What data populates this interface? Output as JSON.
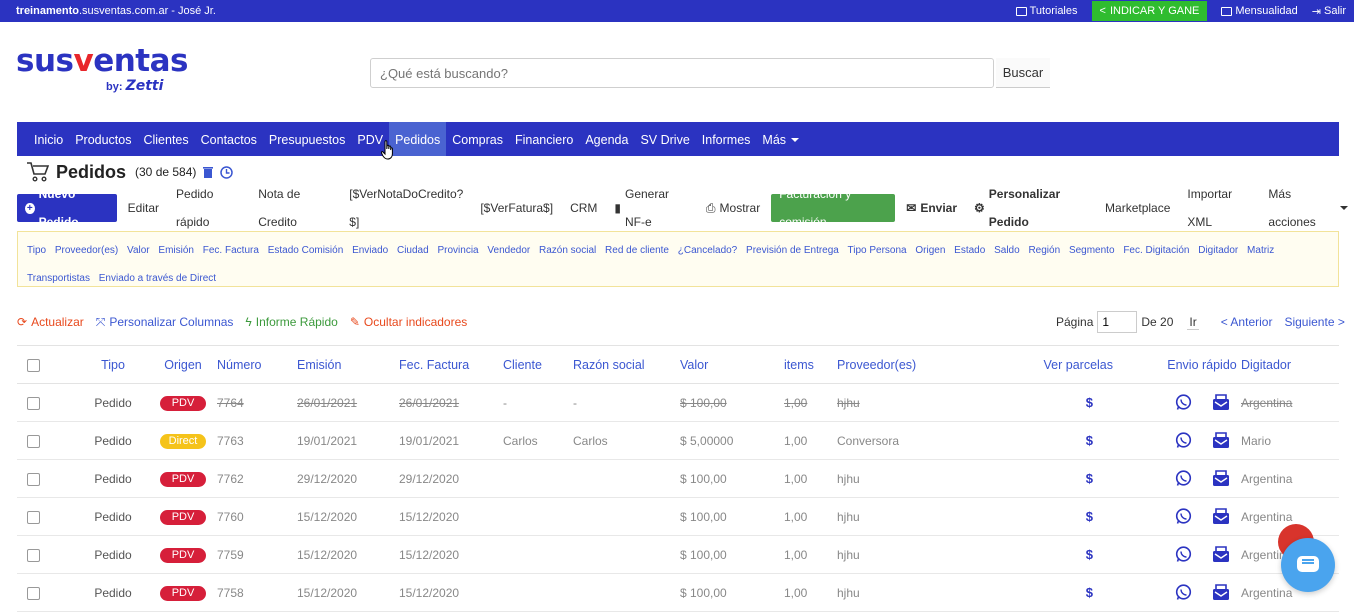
{
  "topbar": {
    "host_bold": "treinamento",
    "host_rest": ".susventas.com.ar - José Jr.",
    "tutoriales": "Tutoriales",
    "indicar": "INDICAR Y GANE",
    "mensualidad": "Mensualidad",
    "salir": "Salir"
  },
  "logo": {
    "brand_a": "sus",
    "brand_v": "v",
    "brand_b": "entas",
    "by": "by:",
    "by_name": "Zetti"
  },
  "search": {
    "placeholder": "¿Qué está buscando?",
    "button": "Buscar"
  },
  "nav": [
    "Inicio",
    "Productos",
    "Clientes",
    "Contactos",
    "Presupuestos",
    "PDV",
    "Pedidos",
    "Compras",
    "Financiero",
    "Agenda",
    "SV Drive",
    "Informes",
    "Más"
  ],
  "nav_active": "Pedidos",
  "page": {
    "title": "Pedidos",
    "count": "(30 de 584)"
  },
  "toolbar": {
    "nuevo": "Nuevo Pedido",
    "editar": "Editar",
    "rapido": "Pedido rápido",
    "nota": "Nota de Credito",
    "vernota": "[$VerNotaDoCredito?$]",
    "verfatura": "[$VerFatura$]",
    "crm": "CRM",
    "nfe": "Generar NF-e",
    "mostrar": "Mostrar",
    "facturacion": "Facturación y comisión",
    "enviar": "Enviar",
    "personalizar": "Personalizar Pedido",
    "marketplace": "Marketplace",
    "importar": "Importar XML",
    "mas": "Más acciones"
  },
  "filters": [
    "Tipo",
    "Proveedor(es)",
    "Valor",
    "Emisión",
    "Fec. Factura",
    "Estado Comisión",
    "Enviado",
    "Ciudad",
    "Provincia",
    "Vendedor",
    "Razón social",
    "Red de cliente",
    "¿Cancelado?",
    "Previsión de Entrega",
    "Tipo Persona",
    "Origen",
    "Estado",
    "Saldo",
    "Región",
    "Segmento",
    "Fec. Digitación",
    "Digitador",
    "Matriz",
    "Transportistas",
    "Enviado a través de Direct"
  ],
  "actions": {
    "actualizar": "Actualizar",
    "personalizar_columnas": "Personalizar Columnas",
    "informe": "Informe Rápido",
    "ocultar": "Ocultar indicadores"
  },
  "colors": {
    "actualizar": "#e8491d",
    "personalizar_columnas": "#3b57d1",
    "informe": "#3c9a3c",
    "ocultar": "#e8491d",
    "pdv": "#d61f3a",
    "direct": "#f5c31a"
  },
  "pager": {
    "pagina": "Página",
    "page": "1",
    "de": "De 20",
    "ir": "Ir",
    "anterior": "< Anterior",
    "siguiente": "Siguiente >"
  },
  "columns": [
    "Tipo",
    "Origen",
    "Número",
    "Emisión",
    "Fec. Factura",
    "Cliente",
    "Razón social",
    "Valor",
    "items",
    "Proveedor(es)",
    "Ver parcelas",
    "Envio rápido",
    "Digitador"
  ],
  "rows": [
    {
      "tipo": "Pedido",
      "origen": "PDV",
      "numero": "7764",
      "emision": "26/01/2021",
      "factura": "26/01/2021",
      "cliente": "-",
      "razon": "-",
      "valor": "$ 100,00",
      "items": "1,00",
      "proveedor": "hjhu",
      "parcelas": "$",
      "digitador": "Argentina",
      "cancelado": true
    },
    {
      "tipo": "Pedido",
      "origen": "Direct",
      "numero": "7763",
      "emision": "19/01/2021",
      "factura": "19/01/2021",
      "cliente": "Carlos",
      "razon": "Carlos",
      "valor": "$ 5,00000",
      "items": "1,00",
      "proveedor": "Conversora",
      "parcelas": "$",
      "digitador": "Mario",
      "cancelado": false
    },
    {
      "tipo": "Pedido",
      "origen": "PDV",
      "numero": "7762",
      "emision": "29/12/2020",
      "factura": "29/12/2020",
      "cliente": "",
      "razon": "",
      "valor": "$ 100,00",
      "items": "1,00",
      "proveedor": "hjhu",
      "parcelas": "$",
      "digitador": "Argentina",
      "cancelado": false
    },
    {
      "tipo": "Pedido",
      "origen": "PDV",
      "numero": "7760",
      "emision": "15/12/2020",
      "factura": "15/12/2020",
      "cliente": "",
      "razon": "",
      "valor": "$ 100,00",
      "items": "1,00",
      "proveedor": "hjhu",
      "parcelas": "$",
      "digitador": "Argentina",
      "cancelado": false
    },
    {
      "tipo": "Pedido",
      "origen": "PDV",
      "numero": "7759",
      "emision": "15/12/2020",
      "factura": "15/12/2020",
      "cliente": "",
      "razon": "",
      "valor": "$ 100,00",
      "items": "1,00",
      "proveedor": "hjhu",
      "parcelas": "$",
      "digitador": "Argentina",
      "cancelado": false
    },
    {
      "tipo": "Pedido",
      "origen": "PDV",
      "numero": "7758",
      "emision": "15/12/2020",
      "factura": "15/12/2020",
      "cliente": "",
      "razon": "",
      "valor": "$ 100,00",
      "items": "1,00",
      "proveedor": "hjhu",
      "parcelas": "$",
      "digitador": "Argentina",
      "cancelado": false
    }
  ]
}
